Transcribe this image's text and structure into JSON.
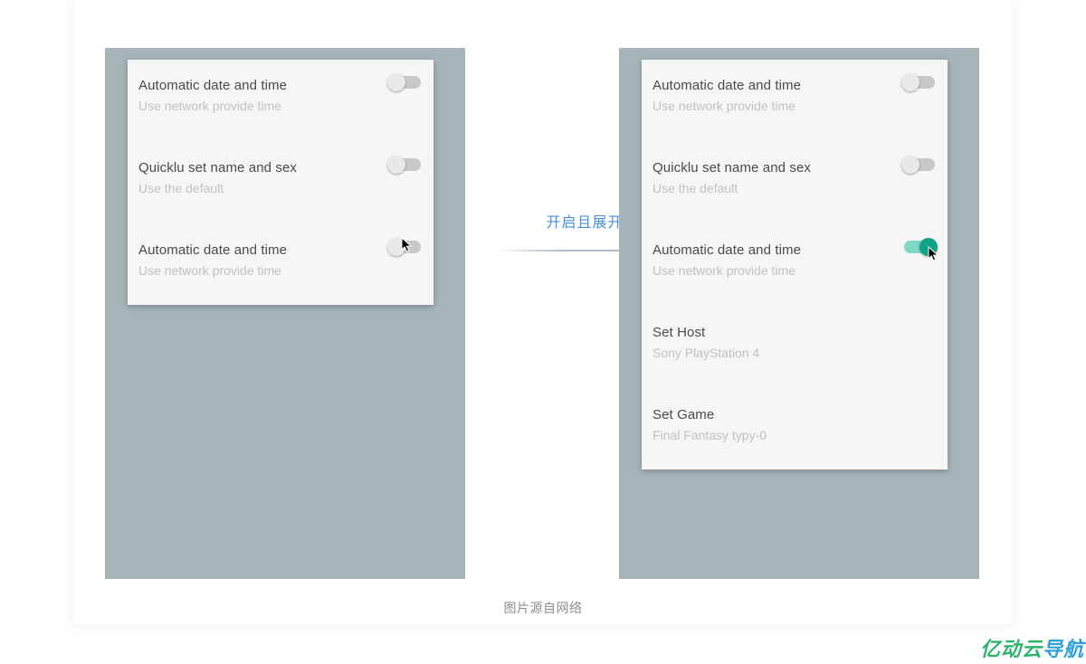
{
  "arrow_label": "开启且展开",
  "caption": "图片源自网络",
  "watermark": {
    "part1": "亿动云",
    "part2": "导航"
  },
  "left_panel": {
    "rows": [
      {
        "title": "Automatic date and time",
        "sub": "Use network provide time",
        "toggle_on": false
      },
      {
        "title": "Quicklu set name and sex",
        "sub": "Use the default",
        "toggle_on": false
      },
      {
        "title": "Automatic date and time",
        "sub": "Use network provide time",
        "toggle_on": false
      }
    ]
  },
  "right_panel": {
    "rows": [
      {
        "title": "Automatic date and time",
        "sub": "Use network provide time",
        "toggle_on": false
      },
      {
        "title": "Quicklu set name and sex",
        "sub": "Use the default",
        "toggle_on": false
      },
      {
        "title": "Automatic date and time",
        "sub": "Use network provide time",
        "toggle_on": true
      },
      {
        "title": "Set Host",
        "sub": "Sony PlayStation 4",
        "toggle_on": null
      },
      {
        "title": "Set Game",
        "sub": "Final Fantasy typy-0",
        "toggle_on": null
      }
    ]
  }
}
